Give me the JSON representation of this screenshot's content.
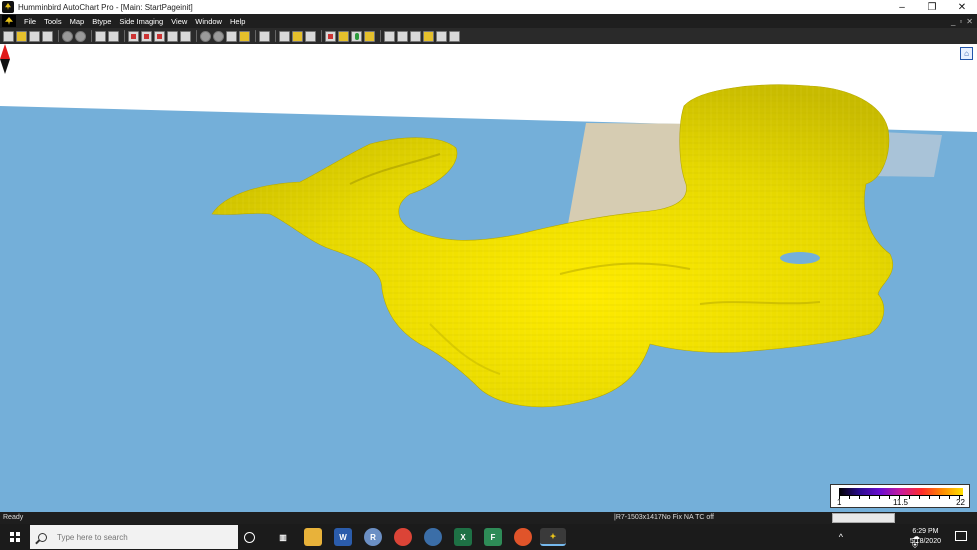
{
  "window": {
    "title": "Humminbird AutoChart Pro - [Main: StartPageinit]",
    "minimize": "–",
    "restore": "❐",
    "close": "✕"
  },
  "menu": {
    "items": [
      "File",
      "Tools",
      "Map",
      "Btype",
      "Side Imaging",
      "View",
      "Window",
      "Help"
    ],
    "mdi_controls": [
      "_",
      "▫",
      "✕"
    ]
  },
  "legend": {
    "min": "1",
    "mid": "11.5",
    "max": "22"
  },
  "status": {
    "left": "Ready",
    "mid": "|R7-1503x1417No Fix   NA  TC off"
  },
  "taskbar": {
    "search_placeholder": "Type here to search",
    "time": "6:29 PM",
    "date": "5/18/2020",
    "tray_chevron": "^"
  },
  "colors": {
    "water": "#74afd9",
    "land": "#d6ccb2",
    "terrain": "#e8e000"
  }
}
